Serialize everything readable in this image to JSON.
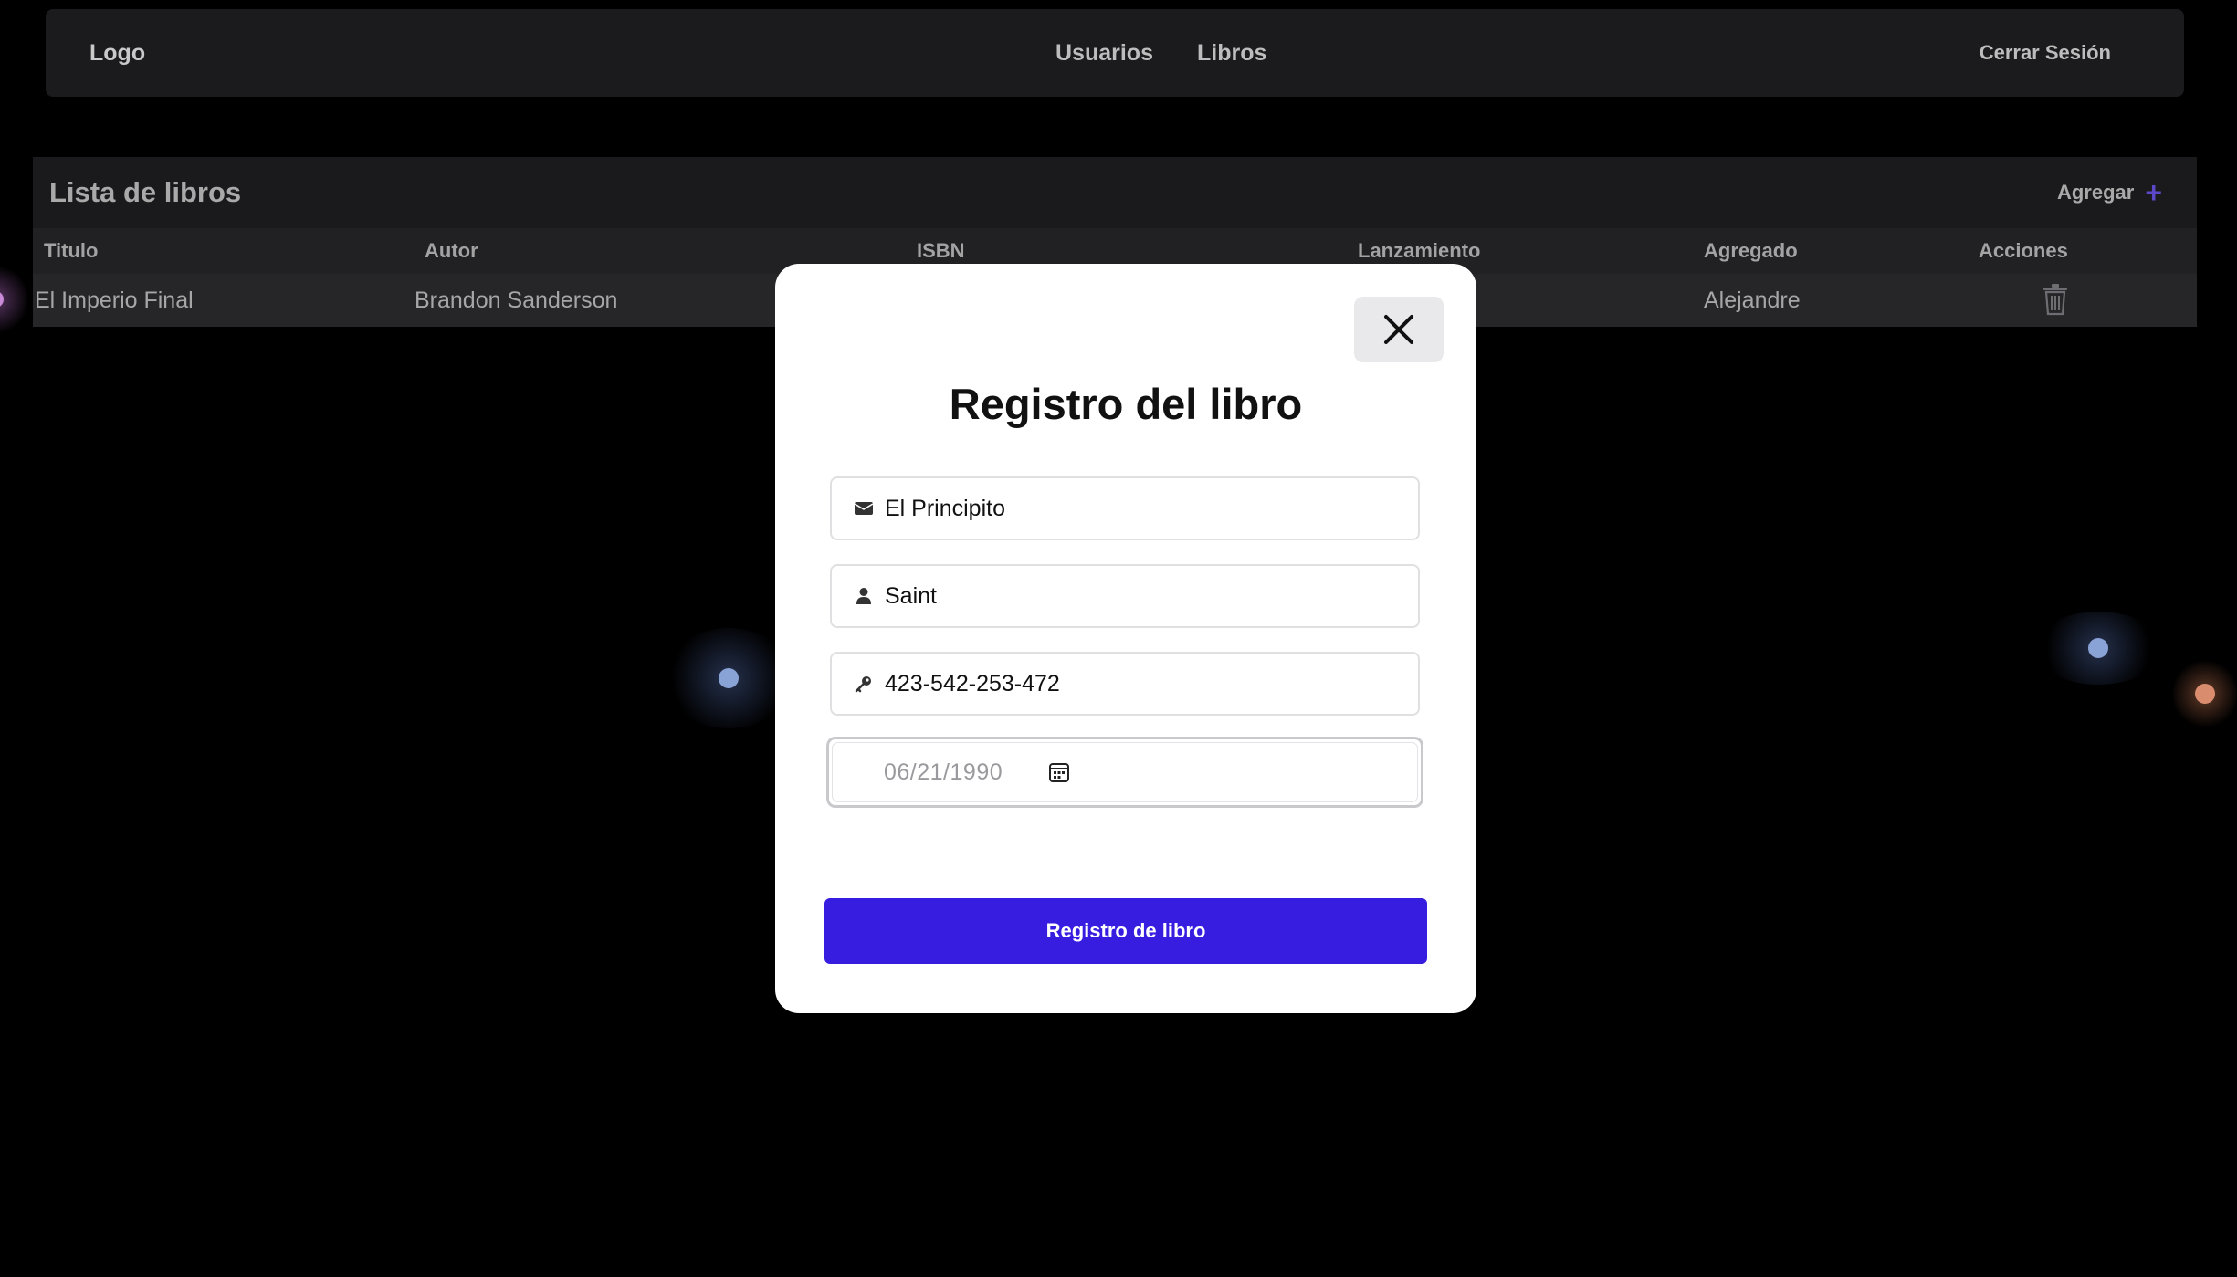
{
  "navbar": {
    "logo": "Logo",
    "links": [
      "Usuarios",
      "Libros"
    ],
    "logout": "Cerrar Sesión"
  },
  "books": {
    "title": "Lista de libros",
    "add_label": "Agregar",
    "columns": [
      "Titulo",
      "Autor",
      "ISBN",
      "Lanzamiento",
      "Agregado",
      "Acciones"
    ],
    "rows": [
      {
        "titulo": "El Imperio Final",
        "autor": "Brandon Sanderson",
        "agregado": "Alejandre"
      }
    ]
  },
  "modal": {
    "title": "Registro del libro",
    "fields": {
      "titulo": "El Principito",
      "autor": "Saint",
      "isbn": "423-542-253-472",
      "fecha": "06/21/1990"
    },
    "submit_label": "Registro de libro"
  },
  "colors": {
    "accent": "#371de0",
    "plus": "#5b48c9"
  },
  "icons": {
    "title_field": "envelope-icon",
    "author_field": "user-icon",
    "isbn_field": "key-icon",
    "date_field": "calendar-icon",
    "close": "close-icon",
    "delete": "trash-icon",
    "add": "plus-icon"
  }
}
